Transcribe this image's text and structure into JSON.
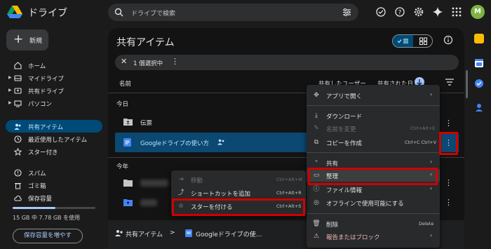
{
  "app": {
    "title": "ドライブ"
  },
  "search": {
    "placeholder": "ドライブで検索"
  },
  "avatar": {
    "initial": "M"
  },
  "sidebar": {
    "new_label": "新規",
    "items": [
      {
        "label": "ホーム"
      },
      {
        "label": "マイドライブ"
      },
      {
        "label": "共有ドライブ"
      },
      {
        "label": "パソコン"
      },
      {
        "label": "共有アイテム"
      },
      {
        "label": "最近使用したアイテム"
      },
      {
        "label": "スター付き"
      },
      {
        "label": "スパム"
      },
      {
        "label": "ゴミ箱"
      },
      {
        "label": "保存容量"
      }
    ],
    "storage_text": "15 GB 中 7.78 GB を使用",
    "storage_fraction": 0.52,
    "upgrade_label": "保存容量を増やす"
  },
  "main": {
    "title": "共有アイテム",
    "selection_text": "1 個選択中",
    "columns": {
      "name": "名前",
      "shared_by": "共有したユーザー",
      "shared_date": "共有された日"
    },
    "sections": {
      "today": "今日",
      "this_year": "今年"
    },
    "rows": [
      {
        "name": "伝票"
      },
      {
        "name": "Googleドライブの使い方"
      }
    ],
    "breadcrumb": {
      "root": "共有アイテム",
      "separator": ">",
      "current": "Googleドライブの使..."
    }
  },
  "context_menu": {
    "items": [
      {
        "label": "アプリで開く",
        "shortcut": ""
      },
      {
        "label": "ダウンロード",
        "shortcut": ""
      },
      {
        "label": "名前を変更",
        "shortcut": "Ctrl+Alt+E"
      },
      {
        "label": "コピーを作成",
        "shortcut": "Ctrl+C Ctrl+V"
      },
      {
        "label": "共有",
        "shortcut": ""
      },
      {
        "label": "整理",
        "shortcut": ""
      },
      {
        "label": "ファイル情報",
        "shortcut": ""
      },
      {
        "label": "オフラインで使用可能にする",
        "shortcut": ""
      },
      {
        "label": "削除",
        "shortcut": "Delete"
      },
      {
        "label": "報告またはブロック",
        "shortcut": ""
      }
    ]
  },
  "submenu": {
    "items": [
      {
        "label": "移動",
        "shortcut": "Ctrl+Alt+M"
      },
      {
        "label": "ショートカットを追加",
        "shortcut": "Ctrl+Alt+R"
      },
      {
        "label": "スターを付ける",
        "shortcut": "Ctrl+Alt+S"
      }
    ]
  },
  "colors": {
    "accent": "#a8c7fa",
    "selected_row": "#0b4872",
    "highlight_box": "#d00000",
    "danger": "#f2b8b5"
  }
}
